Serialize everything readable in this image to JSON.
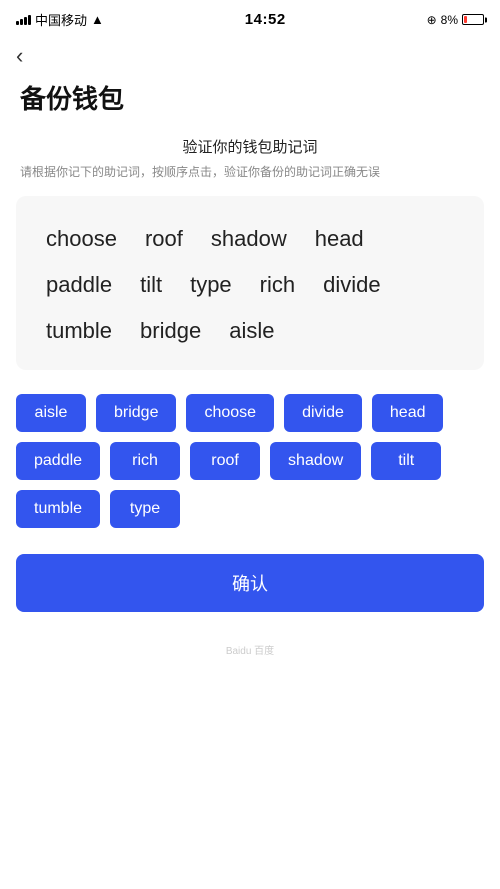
{
  "statusBar": {
    "carrier": "中国移动",
    "time": "14:52",
    "batteryPercent": "8%"
  },
  "page": {
    "backLabel": "‹",
    "title": "备份钱包",
    "sectionHeading": "验证你的钱包助记词",
    "sectionDesc": "请根据你记下的助记词，按顺序点击，验证你备份的助记词正确无误",
    "displayWords": [
      "choose",
      "roof",
      "shadow",
      "head",
      "paddle",
      "tilt",
      "type",
      "rich",
      "divide",
      "tumble",
      "bridge",
      "aisle"
    ],
    "buttonWords": [
      "aisle",
      "bridge",
      "choose",
      "divide",
      "head",
      "paddle",
      "rich",
      "roof",
      "shadow",
      "tilt",
      "tumble",
      "type"
    ],
    "confirmLabel": "确认"
  }
}
